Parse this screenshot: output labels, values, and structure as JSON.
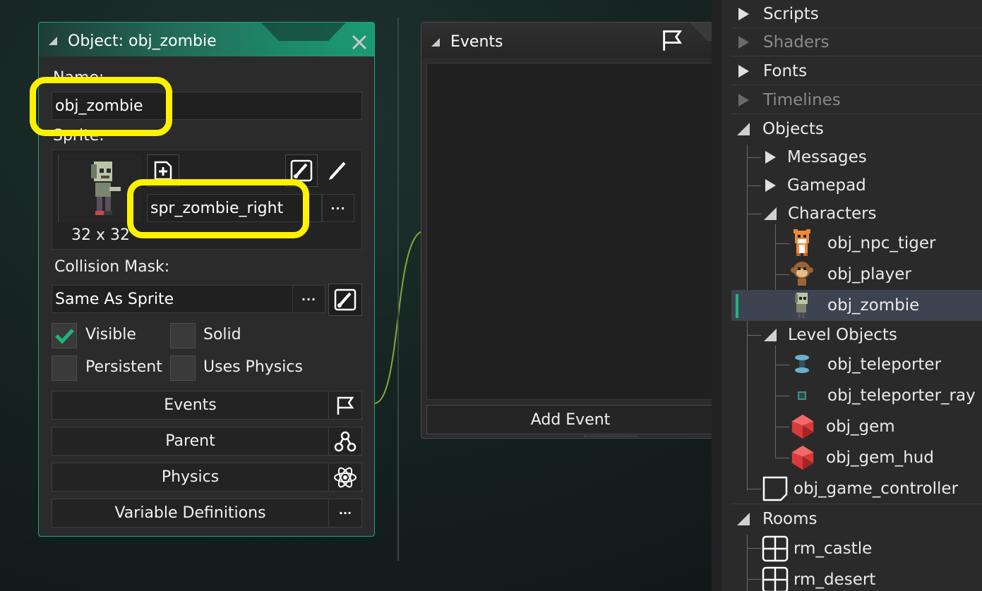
{
  "object_window": {
    "title": "Object: obj_zombie",
    "name_label": "Name:",
    "name_value": "obj_zombie",
    "sprite_label": "Sprite:",
    "sprite_name": "spr_zombie_right",
    "sprite_size": "32 x 32",
    "collision_label": "Collision Mask:",
    "collision_value": "Same As Sprite",
    "checkboxes": {
      "visible": {
        "label": "Visible",
        "checked": true
      },
      "solid": {
        "label": "Solid",
        "checked": false
      },
      "persistent": {
        "label": "Persistent",
        "checked": false
      },
      "uses_physics": {
        "label": "Uses Physics",
        "checked": false
      }
    },
    "buttons": {
      "events": "Events",
      "parent": "Parent",
      "physics": "Physics",
      "variable_definitions": "Variable Definitions"
    },
    "dots": "···"
  },
  "events_window": {
    "title": "Events",
    "add_event": "Add Event"
  },
  "tree": {
    "top_folders": [
      {
        "label": "Scripts",
        "enabled": true
      },
      {
        "label": "Shaders",
        "enabled": false
      },
      {
        "label": "Fonts",
        "enabled": true
      },
      {
        "label": "Timelines",
        "enabled": false
      },
      {
        "label": "Objects",
        "enabled": true,
        "expanded": true
      }
    ],
    "objects": {
      "messages": "Messages",
      "gamepad": "Gamepad",
      "characters": "Characters",
      "character_items": [
        "obj_npc_tiger",
        "obj_player",
        "obj_zombie"
      ],
      "level_objects": "Level Objects",
      "level_items": [
        "obj_teleporter",
        "obj_teleporter_ray",
        "obj_gem",
        "obj_gem_hud"
      ],
      "game_controller": "obj_game_controller"
    },
    "rooms": {
      "label": "Rooms",
      "items": [
        "rm_castle",
        "rm_desert"
      ]
    },
    "selected": "obj_zombie"
  },
  "colors": {
    "accent": "#1aa67b",
    "highlight": "#fff200",
    "check": "#1fb57a"
  }
}
